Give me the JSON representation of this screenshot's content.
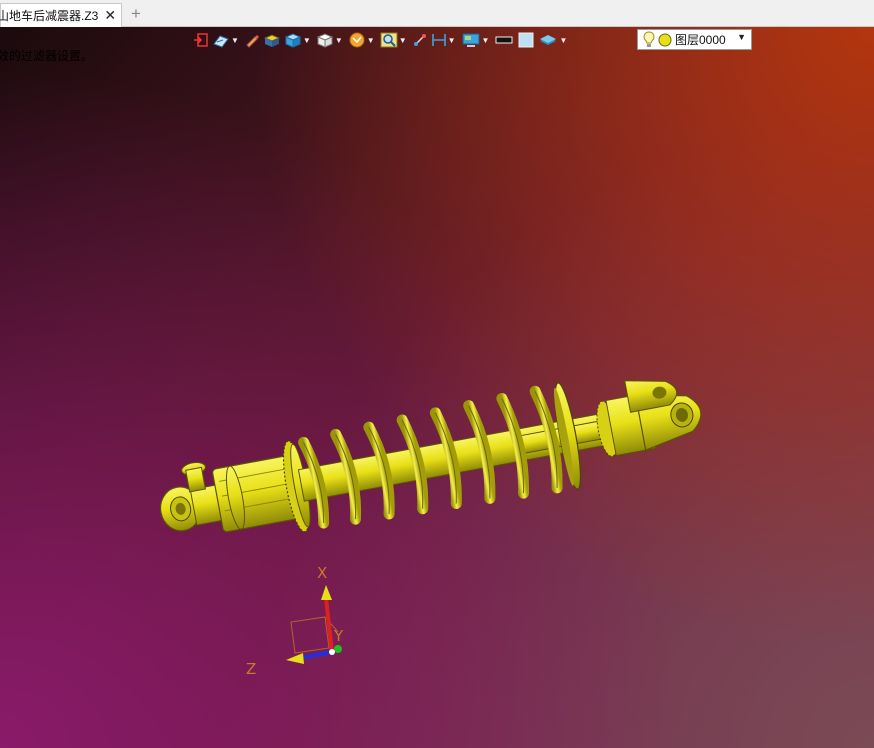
{
  "tab": {
    "title": "山地车后减震器.Z3",
    "close_glyph": "✕",
    "add_glyph": "+"
  },
  "viewport": {
    "filter_message": "效的过滤器设置。",
    "background_colors": [
      "#1b0a0d",
      "#6a1c3d",
      "#b3360d",
      "#8a1a6a"
    ]
  },
  "toolbar": {
    "items": [
      {
        "icon": "exit-icon"
      },
      {
        "icon": "display-mode-icon"
      },
      {
        "icon": "pencil-icon"
      },
      {
        "icon": "shaded-box-icon"
      },
      {
        "icon": "view-cube-icon"
      },
      {
        "icon": "wire-cube-icon"
      },
      {
        "icon": "render-style-icon"
      },
      {
        "icon": "zoom-icon"
      },
      {
        "icon": "pick-icon"
      },
      {
        "icon": "dimension-icon"
      },
      {
        "icon": "display-settings-icon"
      },
      {
        "icon": "line-color-icon"
      },
      {
        "icon": "face-color-icon"
      },
      {
        "icon": "layer-stack-icon"
      }
    ],
    "layer": {
      "name": "图层0000",
      "bulb_icon": "lightbulb-icon",
      "dot_color": "#e8e016"
    }
  },
  "model": {
    "name": "山地车后减震器",
    "color": "#e8e016"
  },
  "triad": {
    "x_label": "X",
    "y_label": "Y",
    "z_label": "Z"
  }
}
